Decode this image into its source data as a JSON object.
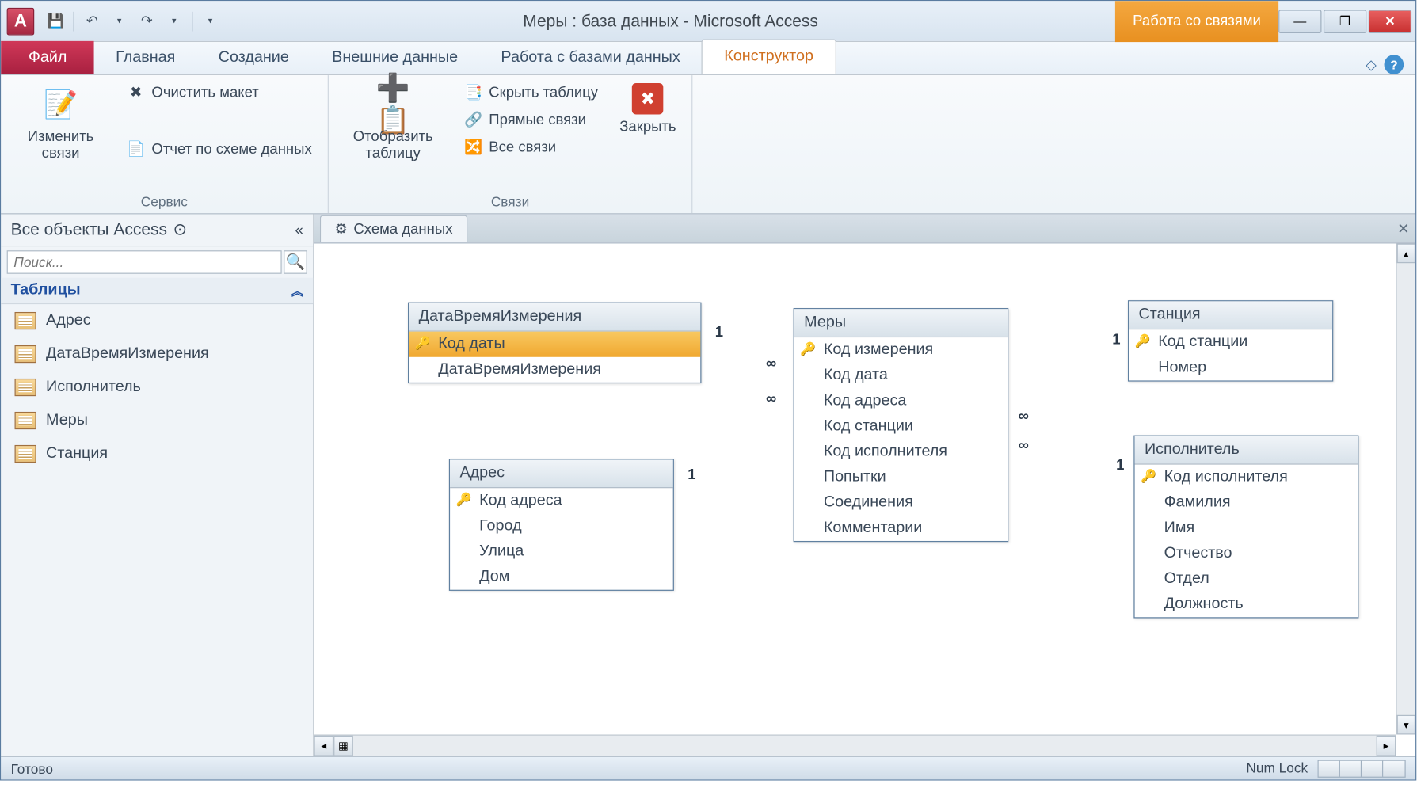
{
  "app_letter": "A",
  "title": "Меры : база данных  -  Microsoft Access",
  "context_tab": "Работа со связями",
  "tabs": {
    "file": "Файл",
    "home": "Главная",
    "create": "Создание",
    "external": "Внешние данные",
    "dbwork": "Работа с базами данных",
    "designer": "Конструктор"
  },
  "ribbon": {
    "group_service": "Сервис",
    "group_relations": "Связи",
    "edit_relations": "Изменить связи",
    "clear_layout": "Очистить макет",
    "schema_report": "Отчет по схеме данных",
    "show_table": "Отобразить таблицу",
    "hide_table": "Скрыть таблицу",
    "direct_relations": "Прямые связи",
    "all_relations": "Все связи",
    "close": "Закрыть"
  },
  "nav": {
    "header": "Все объекты Access",
    "search_placeholder": "Поиск...",
    "group_tables": "Таблицы",
    "items": [
      "Адрес",
      "ДатаВремяИзмерения",
      "Исполнитель",
      "Меры",
      "Станция"
    ]
  },
  "canvas_tab": "Схема данных",
  "tables": {
    "datetime": {
      "title": "ДатаВремяИзмерения",
      "fields": [
        "Код даты",
        "ДатаВремяИзмерения"
      ],
      "pk": 0
    },
    "address": {
      "title": "Адрес",
      "fields": [
        "Код адреса",
        "Город",
        "Улица",
        "Дом"
      ],
      "pk": 0
    },
    "measures": {
      "title": "Меры",
      "fields": [
        "Код измерения",
        "Код дата",
        "Код адреса",
        "Код станции",
        "Код исполнителя",
        "Попытки",
        "Соединения",
        "Комментарии"
      ],
      "pk": 0
    },
    "station": {
      "title": "Станция",
      "fields": [
        "Код станции",
        "Номер"
      ],
      "pk": 0
    },
    "performer": {
      "title": "Исполнитель",
      "fields": [
        "Код исполнителя",
        "Фамилия",
        "Имя",
        "Отчество",
        "Отдел",
        "Должность"
      ],
      "pk": 0
    }
  },
  "rel_labels": {
    "one": "1",
    "many": "∞"
  },
  "status": {
    "ready": "Готово",
    "numlock": "Num Lock"
  }
}
